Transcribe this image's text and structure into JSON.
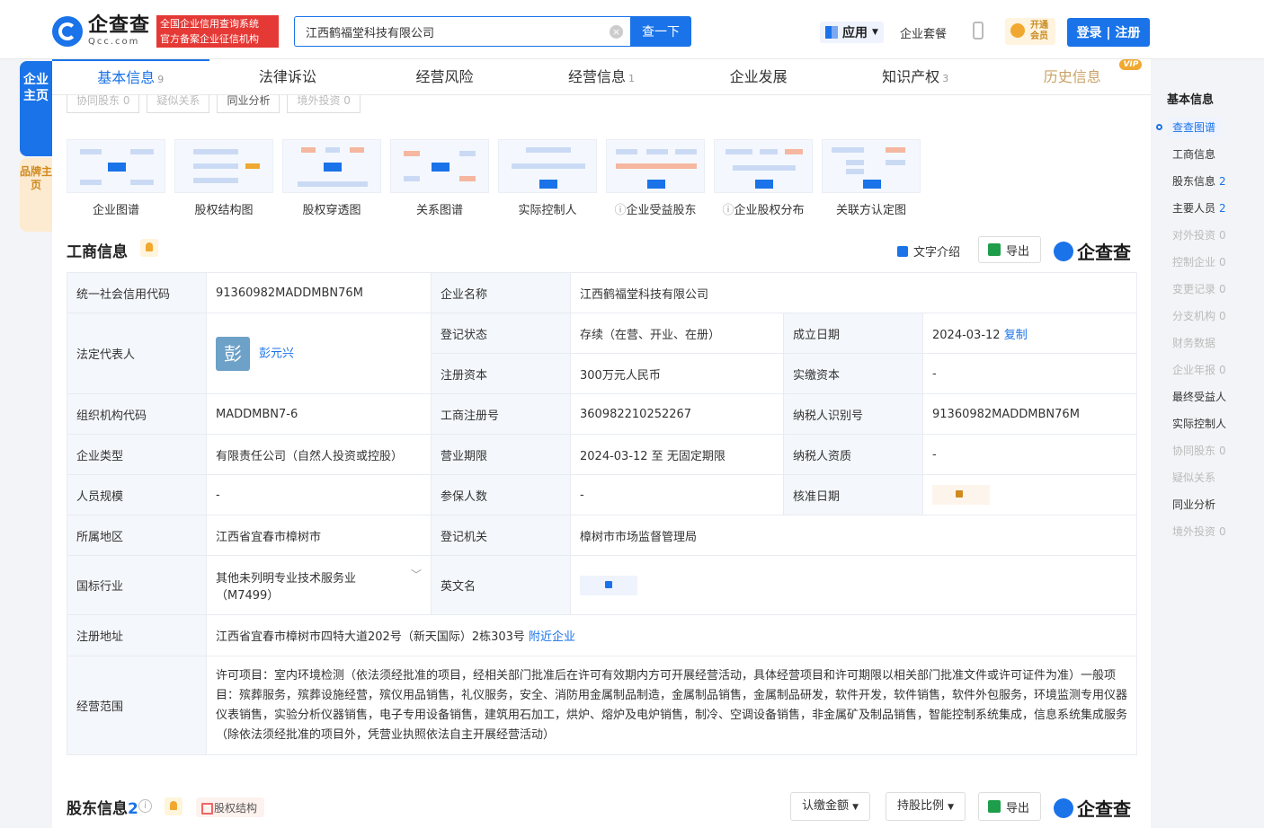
{
  "header": {
    "logo_cn": "企查查",
    "logo_en": "Qcc.com",
    "tagline1": "全国企业信用查询系统",
    "tagline2": "官方备案企业征信机构",
    "search_value": "江西鹤福堂科技有限公司",
    "search_button": "查一下",
    "apps": "应用",
    "package": "企业套餐",
    "vip_open1": "开通",
    "vip_open2": "会员",
    "login": "登录 | 注册"
  },
  "left_tabs": {
    "company_home": "企业主页",
    "brand_home": "品牌主页"
  },
  "nav_tabs": [
    {
      "label": "基本信息",
      "count": "9"
    },
    {
      "label": "法律诉讼",
      "count": ""
    },
    {
      "label": "经营风险",
      "count": ""
    },
    {
      "label": "经营信息",
      "count": "1"
    },
    {
      "label": "企业发展",
      "count": ""
    },
    {
      "label": "知识产权",
      "count": "3"
    },
    {
      "label": "历史信息",
      "count": "",
      "badge": "VIP"
    }
  ],
  "sub_tabs": [
    "协同股东 0",
    "疑似关系",
    "同业分析",
    "境外投资 0"
  ],
  "graph_cards": [
    "企业图谱",
    "股权结构图",
    "股权穿透图",
    "关系图谱",
    "实际控制人",
    "企业受益股东",
    "企业股权分布",
    "关联方认定图"
  ],
  "business": {
    "title": "工商信息",
    "intro": "文字介绍",
    "export": "导出",
    "brand": "企查查",
    "rows": {
      "credit_code_k": "统一社会信用代码",
      "credit_code_v": "91360982MADDMBN76M",
      "name_k": "企业名称",
      "name_v": "江西鹤福堂科技有限公司",
      "legal_k": "法定代表人",
      "legal_avatar": "彭",
      "legal_v": "彭元兴",
      "status_k": "登记状态",
      "status_v": "存续（在营、开业、在册）",
      "found_k": "成立日期",
      "found_v": "2024-03-12",
      "copy": "复制",
      "capital_k": "注册资本",
      "capital_v": "300万元人民币",
      "paid_k": "实缴资本",
      "paid_v": "-",
      "org_k": "组织机构代码",
      "org_v": "MADDMBN7-6",
      "reg_no_k": "工商注册号",
      "reg_no_v": "360982210252267",
      "tax_k": "纳税人识别号",
      "tax_v": "91360982MADDMBN76M",
      "type_k": "企业类型",
      "type_v": "有限责任公司（自然人投资或控股）",
      "term_k": "营业期限",
      "term_v": "2024-03-12 至 无固定期限",
      "taxq_k": "纳税人资质",
      "taxq_v": "-",
      "staff_k": "人员规模",
      "staff_v": "-",
      "insured_k": "参保人数",
      "insured_v": "-",
      "approve_k": "核准日期",
      "region_k": "所属地区",
      "region_v": "江西省宜春市樟树市",
      "authority_k": "登记机关",
      "authority_v": "樟树市市场监督管理局",
      "industry_k": "国标行业",
      "industry_v": "其他未列明专业技术服务业（M7499）",
      "en_k": "英文名",
      "addr_k": "注册地址",
      "addr_v": "江西省宜春市樟树市四特大道202号（新天国际）2栋303号",
      "nearby": "附近企业",
      "scope_k": "经营范围",
      "scope_v": "许可项目：室内环境检测（依法须经批准的项目，经相关部门批准后在许可有效期内方可开展经营活动，具体经营项目和许可期限以相关部门批准文件或许可证件为准）一般项目：殡葬服务，殡葬设施经营，殡仪用品销售，礼仪服务，安全、消防用金属制品制造，金属制品销售，金属制品研发，软件开发，软件销售，软件外包服务，环境监测专用仪器仪表销售，实验分析仪器销售，电子专用设备销售，建筑用石加工，烘炉、熔炉及电炉销售，制冷、空调设备销售，非金属矿及制品销售，智能控制系统集成，信息系统集成服务（除依法须经批准的项目外，凭营业执照依法自主开展经营活动）"
    }
  },
  "shareholders": {
    "title": "股东信息",
    "count": "2",
    "equity": "股权结构",
    "sub_amount": "认缴金额",
    "ratio": "持股比例",
    "export": "导出",
    "brand": "企查查"
  },
  "right_nav": {
    "head": "基本信息",
    "items": [
      {
        "label": "查查图谱",
        "count": "",
        "state": "active"
      },
      {
        "label": "工商信息",
        "count": "",
        "state": ""
      },
      {
        "label": "股东信息",
        "count": "2",
        "state": ""
      },
      {
        "label": "主要人员",
        "count": "2",
        "state": ""
      },
      {
        "label": "对外投资",
        "count": "0",
        "state": "dim"
      },
      {
        "label": "控制企业",
        "count": "0",
        "state": "dim"
      },
      {
        "label": "变更记录",
        "count": "0",
        "state": "dim"
      },
      {
        "label": "分支机构",
        "count": "0",
        "state": "dim"
      },
      {
        "label": "财务数据",
        "count": "",
        "state": "dim"
      },
      {
        "label": "企业年报",
        "count": "0",
        "state": "dim"
      },
      {
        "label": "最终受益人",
        "count": "",
        "state": ""
      },
      {
        "label": "实际控制人",
        "count": "",
        "state": ""
      },
      {
        "label": "协同股东",
        "count": "0",
        "state": "dim"
      },
      {
        "label": "疑似关系",
        "count": "",
        "state": "dim"
      },
      {
        "label": "同业分析",
        "count": "",
        "state": ""
      },
      {
        "label": "境外投资",
        "count": "0",
        "state": "dim"
      }
    ]
  },
  "colors": {
    "accent": "#1a73e8",
    "red": "#e53935",
    "gold": "#f0a830"
  }
}
